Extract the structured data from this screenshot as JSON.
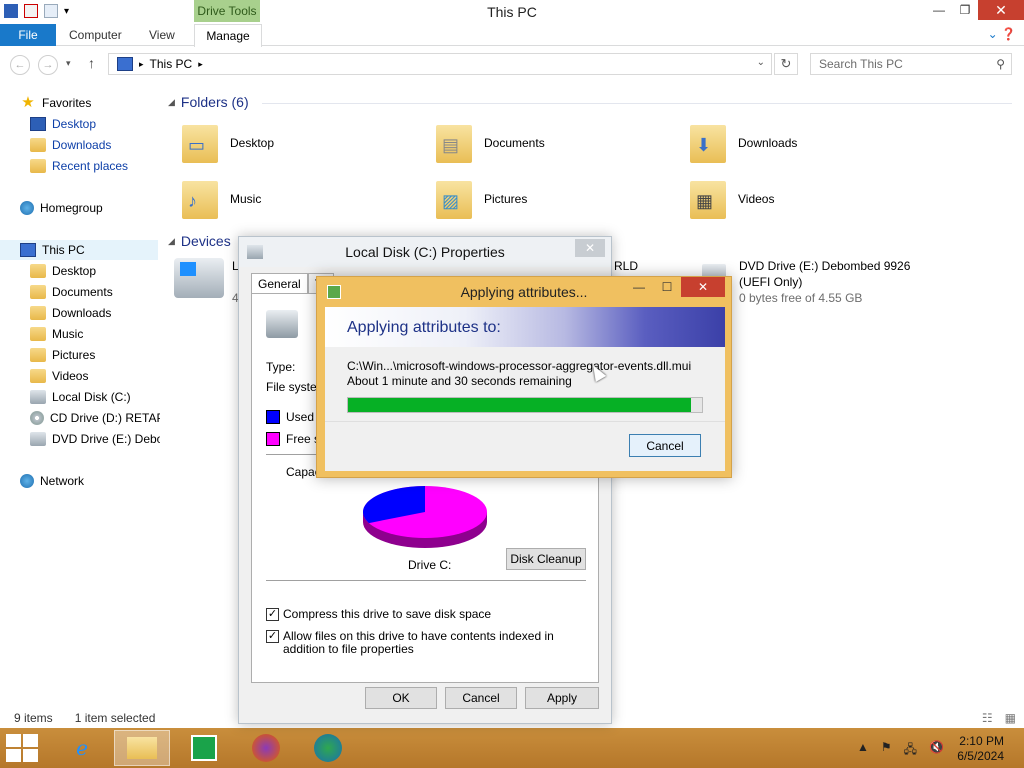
{
  "window": {
    "title": "This PC",
    "contextual_tab": "Drive Tools",
    "controls": {
      "minimize": "—",
      "restore": "❐",
      "close": "✕"
    }
  },
  "ribbon": {
    "file": "File",
    "tabs": [
      "Computer",
      "View",
      "Manage"
    ]
  },
  "address": {
    "path": "This PC",
    "search_placeholder": "Search This PC"
  },
  "nav": {
    "favorites": "Favorites",
    "fav_items": [
      "Desktop",
      "Downloads",
      "Recent places"
    ],
    "homegroup": "Homegroup",
    "thispc": "This PC",
    "pc_items": [
      "Desktop",
      "Documents",
      "Downloads",
      "Music",
      "Pictures",
      "Videos",
      "Local Disk (C:)",
      "CD Drive (D:) RETAP",
      "DVD Drive (E:) Debom"
    ],
    "network": "Network"
  },
  "content": {
    "folders_header": "Folders (6)",
    "folders": [
      "Desktop",
      "Documents",
      "Downloads",
      "Music",
      "Pictures",
      "Videos"
    ],
    "devices_header": "Devices",
    "local_disk_partial": "L",
    "local_disk_size_partial": "4",
    "cd_partial": "RLD",
    "dvd_name": "DVD Drive (E:) Debombed 9926",
    "dvd_sub": "(UEFI Only)",
    "dvd_free": "0 bytes free of 4.55 GB"
  },
  "status": {
    "items": "9 items",
    "selected": "1 item selected"
  },
  "properties": {
    "title": "Local Disk (C:) Properties",
    "tabs": [
      "General",
      "To"
    ],
    "type_label": "Type:",
    "fs_label": "File system",
    "used_label": "Used s",
    "free_label": "Free s",
    "capacity_label": "Capaci",
    "drive_caption": "Drive C:",
    "cleanup": "Disk Cleanup",
    "compress": "Compress this drive to save disk space",
    "index": "Allow files on this drive to have contents indexed in addition to file properties",
    "ok": "OK",
    "cancel": "Cancel",
    "apply": "Apply",
    "used_fraction": 0.32,
    "used_color": "#0000ff",
    "free_color": "#ff00ff"
  },
  "applying": {
    "title": "Applying attributes...",
    "banner": "Applying attributes to:",
    "path": "C:\\Win...\\microsoft-windows-processor-aggregator-events.dll.mui",
    "time": "About 1 minute and 30 seconds remaining",
    "progress": 0.97,
    "cancel": "Cancel"
  },
  "taskbar": {
    "time": "2:10 PM",
    "date": "6/5/2024"
  }
}
